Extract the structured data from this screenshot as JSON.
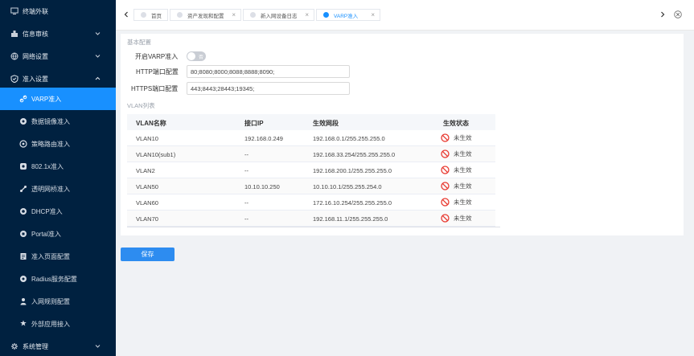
{
  "sidebar": {
    "items": [
      {
        "label": "终端外联",
        "icon": "terminal-icon"
      },
      {
        "label": "信息审核",
        "icon": "audit-icon"
      },
      {
        "label": "网络设置",
        "icon": "globe-icon"
      },
      {
        "label": "准入设置",
        "icon": "shield-icon"
      },
      {
        "label": "VARP准入",
        "icon": "link-icon"
      },
      {
        "label": "数据镜像准入",
        "icon": "mirror-icon"
      },
      {
        "label": "策略路由准入",
        "icon": "route-icon"
      },
      {
        "label": "802.1x准入",
        "icon": "dot1x-icon"
      },
      {
        "label": "透明网桥准入",
        "icon": "bridge-icon"
      },
      {
        "label": "DHCP准入",
        "icon": "dhcp-icon"
      },
      {
        "label": "Portal准入",
        "icon": "portal-icon"
      },
      {
        "label": "准入页面配置",
        "icon": "page-icon"
      },
      {
        "label": "Radius服务配置",
        "icon": "radius-icon"
      },
      {
        "label": "入网规则配置",
        "icon": "rule-icon"
      },
      {
        "label": "外部应用接入",
        "icon": "app-icon"
      },
      {
        "label": "系统管理",
        "icon": "system-icon"
      }
    ]
  },
  "tabs": [
    {
      "label": "首页",
      "closable": false
    },
    {
      "label": "资产发现和配置",
      "closable": true
    },
    {
      "label": "新入网设备日志",
      "closable": true
    },
    {
      "label": "VARP准入",
      "closable": true,
      "active": true
    }
  ],
  "form": {
    "section_basic": "基本配置",
    "varp_label": "开启VARP准入",
    "varp_toggle_text": "否",
    "http_label": "HTTP端口配置",
    "http_value": "80;8080;8000;8088;8888;8090;",
    "https_label": "HTTPS端口配置",
    "https_value": "443;8443;28443;19345;",
    "section_vlan": "VLAN列表"
  },
  "table": {
    "columns": [
      "VLAN名称",
      "接口IP",
      "生效网段",
      "生效状态"
    ],
    "rows": [
      [
        "VLAN10",
        "192.168.0.249",
        "192.168.0.1/255.255.255.0",
        "未生效"
      ],
      [
        "VLAN10(sub1)",
        "--",
        "192.168.33.254/255.255.255.0",
        "未生效"
      ],
      [
        "VLAN2",
        "--",
        "192.168.200.1/255.255.255.0",
        "未生效"
      ],
      [
        "VLAN50",
        "10.10.10.250",
        "10.10.10.1/255.255.254.0",
        "未生效"
      ],
      [
        "VLAN60",
        "--",
        "172.16.10.254/255.255.255.0",
        "未生效"
      ],
      [
        "VLAN70",
        "--",
        "192.168.11.1/255.255.255.0",
        "未生效"
      ]
    ]
  },
  "save_label": "保存",
  "colors": {
    "sidebar_bg": "#002140",
    "accent": "#1890ff",
    "status_red": "#e8382f"
  }
}
